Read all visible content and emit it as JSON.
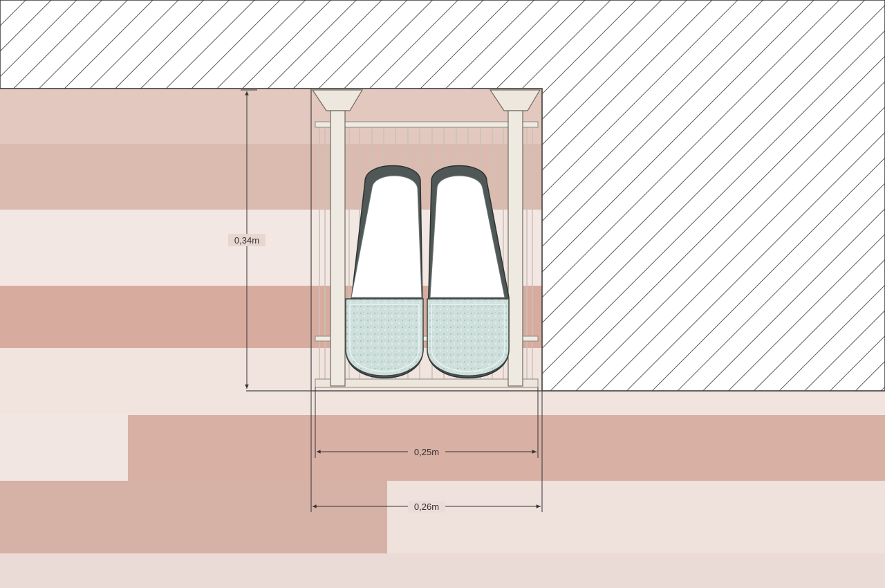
{
  "dimensions": {
    "height_label": "0,34m",
    "inner_width_label": "0,25m",
    "outer_width_label": "0,26m"
  },
  "colors": {
    "wall_background": "#ffffff",
    "hatch_line": "#333333",
    "floor_light": "#f0e3de",
    "floor_dark": "#d9b2a6",
    "rack_frame": "#ece6dc",
    "slipper_sole": "#4f5857",
    "slipper_strap": "#cfe0dc",
    "dimension_line": "#333333"
  },
  "icons": {
    "slipper_left": "slipper-icon",
    "slipper_right": "slipper-icon"
  }
}
